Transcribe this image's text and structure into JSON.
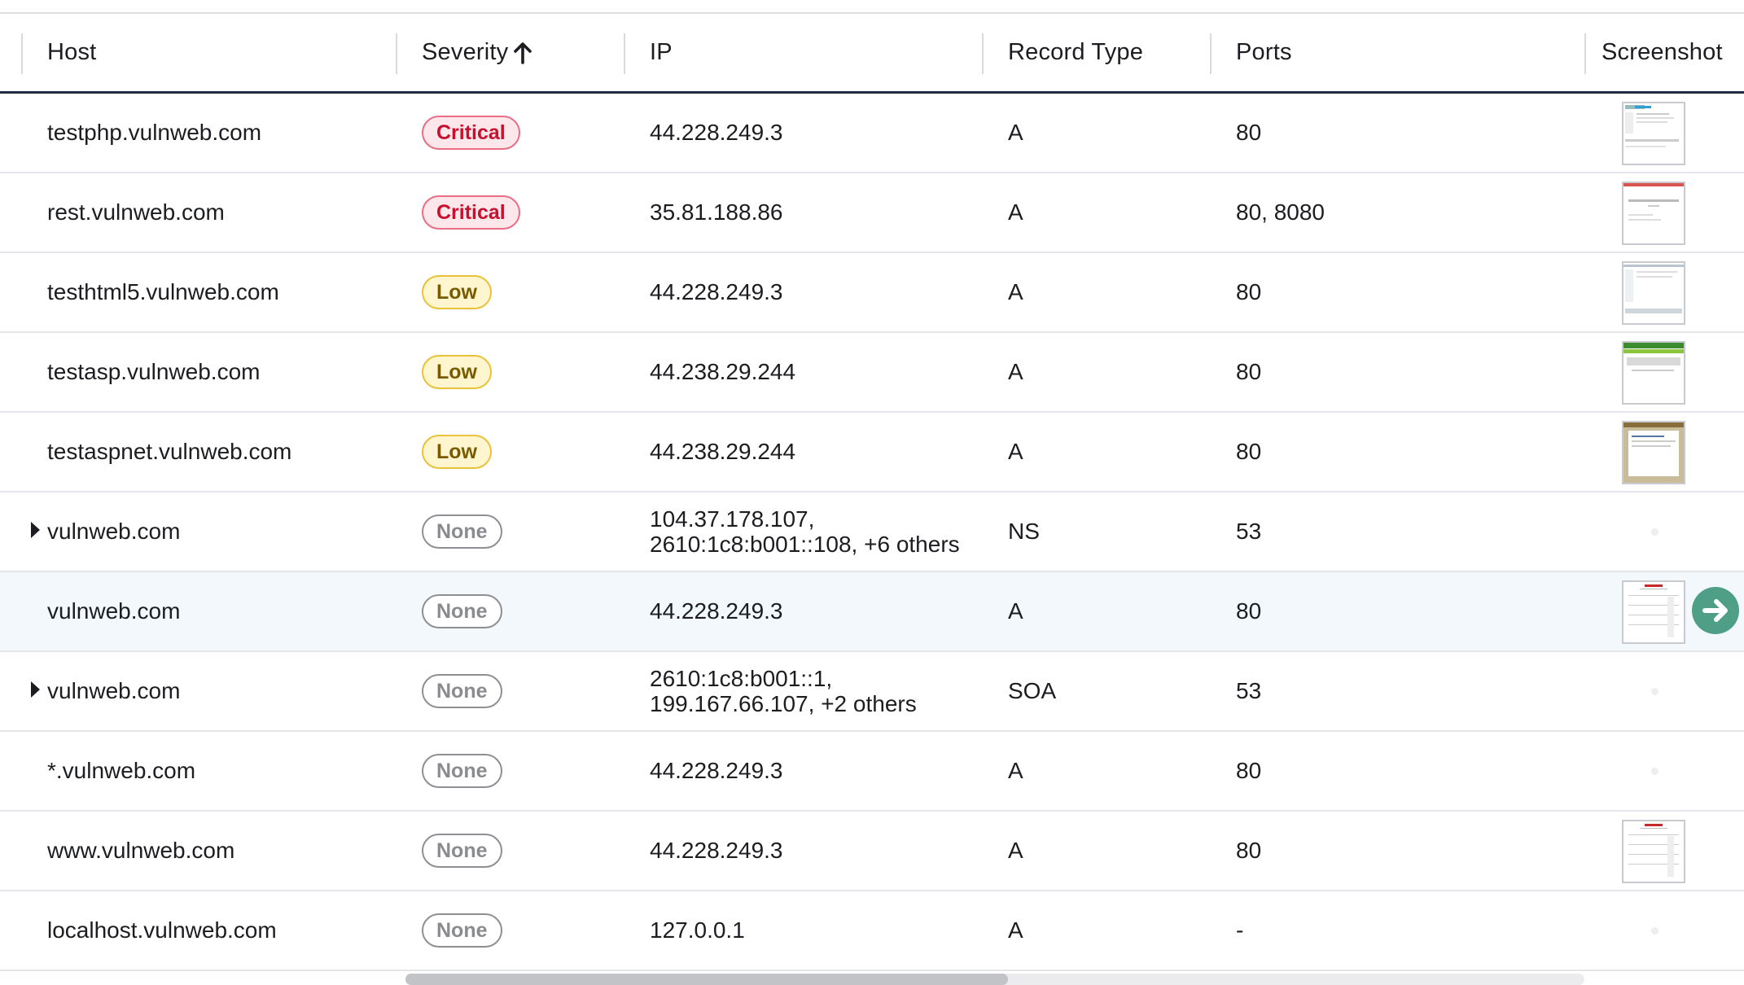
{
  "columns": {
    "host": "Host",
    "severity": "Severity",
    "ip": "IP",
    "record_type": "Record Type",
    "ports": "Ports",
    "screenshot": "Screenshot"
  },
  "sort": {
    "column": "Severity",
    "direction": "ascending",
    "icon": "arrow-up-icon"
  },
  "colors": {
    "critical": "#c8102e",
    "low": "#7a5a00",
    "none": "#8a8b8f",
    "header_rule": "#1f2a44",
    "highlight_row": "#f3f8fd",
    "action_button": "#4f9e86"
  },
  "rows": [
    {
      "host": "testphp.vulnweb.com",
      "severity": "Critical",
      "ip": "44.228.249.3",
      "record_type": "A",
      "ports": "80",
      "screenshot": "thumbnail"
    },
    {
      "host": "rest.vulnweb.com",
      "severity": "Critical",
      "ip": "35.81.188.86",
      "record_type": "A",
      "ports": "80, 8080",
      "screenshot": "thumbnail"
    },
    {
      "host": "testhtml5.vulnweb.com",
      "severity": "Low",
      "ip": "44.228.249.3",
      "record_type": "A",
      "ports": "80",
      "screenshot": "thumbnail"
    },
    {
      "host": "testasp.vulnweb.com",
      "severity": "Low",
      "ip": "44.238.29.244",
      "record_type": "A",
      "ports": "80",
      "screenshot": "thumbnail"
    },
    {
      "host": "testaspnet.vulnweb.com",
      "severity": "Low",
      "ip": "44.238.29.244",
      "record_type": "A",
      "ports": "80",
      "screenshot": "thumbnail"
    },
    {
      "host": "vulnweb.com",
      "severity": "None",
      "ip_line1": "104.37.178.107,",
      "ip_line2": "2610:1c8:b001::108, +6 others",
      "record_type": "NS",
      "ports": "53",
      "expandable": true,
      "screenshot": "none"
    },
    {
      "host": "vulnweb.com",
      "severity": "None",
      "ip": "44.228.249.3",
      "record_type": "A",
      "ports": "80",
      "screenshot": "thumbnail",
      "hovered": true,
      "action_icon": "arrow-right-circle-icon"
    },
    {
      "host": "vulnweb.com",
      "severity": "None",
      "ip_line1": "2610:1c8:b001::1,",
      "ip_line2": "199.167.66.107, +2 others",
      "record_type": "SOA",
      "ports": "53",
      "expandable": true,
      "screenshot": "none"
    },
    {
      "host": "*.vulnweb.com",
      "severity": "None",
      "ip": "44.228.249.3",
      "record_type": "A",
      "ports": "80",
      "screenshot": "none"
    },
    {
      "host": "www.vulnweb.com",
      "severity": "None",
      "ip": "44.228.249.3",
      "record_type": "A",
      "ports": "80",
      "screenshot": "thumbnail"
    },
    {
      "host": "localhost.vulnweb.com",
      "severity": "None",
      "ip": "127.0.0.1",
      "record_type": "A",
      "ports": "-",
      "screenshot": "none"
    }
  ]
}
